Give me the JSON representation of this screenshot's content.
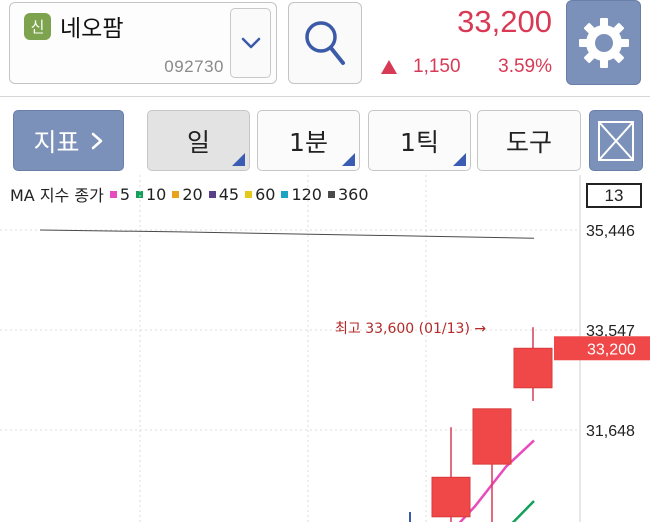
{
  "stock": {
    "badge": "신",
    "name": "네오팜",
    "code": "092730",
    "price": "33,200",
    "change_abs": "1,150",
    "change_pct": "3.59%",
    "change_direction": "up",
    "up_color": "#d83a56"
  },
  "toolbar": {
    "indicator_label": "지표",
    "day_label": "일",
    "minute_label": "1분",
    "tick_label": "1틱",
    "tools_label": "도구"
  },
  "legend": {
    "title": "MA 지수 종가",
    "items": [
      {
        "label": "5",
        "color": "#e84bbd"
      },
      {
        "label": "10",
        "color": "#12a15a"
      },
      {
        "label": "20",
        "color": "#e8a21b"
      },
      {
        "label": "45",
        "color": "#5a3f8a"
      },
      {
        "label": "60",
        "color": "#e6c81a"
      },
      {
        "label": "120",
        "color": "#1aa3c2"
      },
      {
        "label": "360",
        "color": "#4a4a4a"
      }
    ]
  },
  "chart_data": {
    "type": "candlestick",
    "visible_count": "13",
    "y_ticks": [
      "35,446",
      "33,547",
      "31,648"
    ],
    "y_tick_values": [
      35446,
      33547,
      31648
    ],
    "current_price_label": "33,200",
    "current_price": 33200,
    "max_annotation": "최고 33,600 (01/13) →",
    "max_value": 33600,
    "candles": [
      {
        "open": 30000,
        "high": 31700,
        "low": 29500,
        "close": 30750
      },
      {
        "open": 31000,
        "high": 32050,
        "low": 29450,
        "close": 32050
      },
      {
        "open": 32450,
        "high": 33600,
        "low": 32200,
        "close": 33200
      }
    ],
    "ma_lines": [
      {
        "name": "5",
        "color": "#e84bbd",
        "points": [
          [
            448,
            29650
          ],
          [
            475,
            30200
          ],
          [
            506,
            30950
          ],
          [
            534,
            31450
          ]
        ]
      },
      {
        "name": "10",
        "color": "#12a15a",
        "points": [
          [
            498,
            29600
          ],
          [
            534,
            30300
          ]
        ]
      },
      {
        "name": "360",
        "color": "#4a4a4a",
        "points": [
          [
            40,
            35446
          ],
          [
            180,
            35410
          ],
          [
            420,
            35330
          ],
          [
            534,
            35290
          ]
        ]
      }
    ]
  }
}
